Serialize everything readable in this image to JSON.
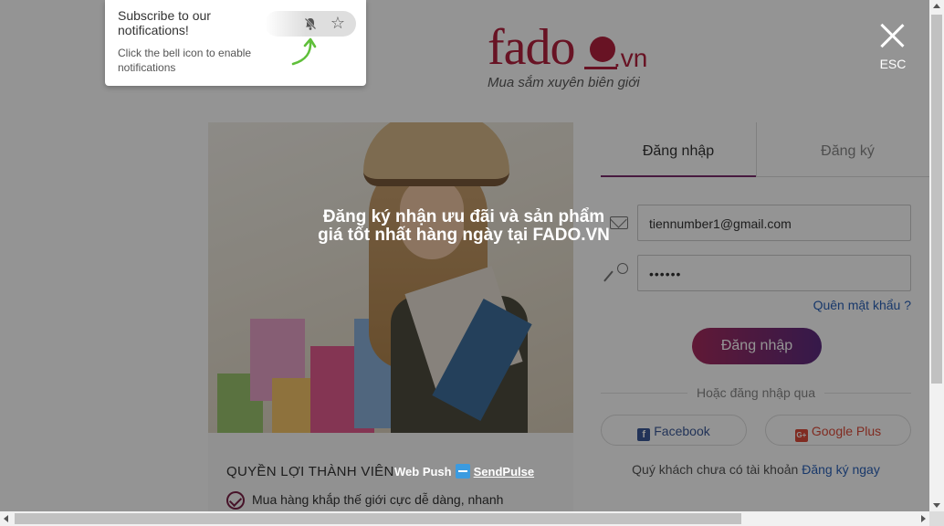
{
  "logo": {
    "brand": "fado",
    "ext": ".vn",
    "tagline": "Mua sắm xuyên biên giới"
  },
  "modal": {
    "close_label": "ESC",
    "headline": "Đăng ký nhận ưu đãi và sản phẩm giá tốt nhất hàng ngày tại FADO.VN",
    "powered_prefix": "Web Push",
    "powered_brand": "SendPulse"
  },
  "notification": {
    "title": "Subscribe to our notifications!",
    "description": "Click the bell icon to enable notifications",
    "star_glyph": "☆"
  },
  "login": {
    "tab_login": "Đăng nhập",
    "tab_register": "Đăng ký",
    "email_value": "tiennumber1@gmail.com",
    "password_value": "••••••",
    "forgot_link": "Quên mật khẩu ?",
    "submit_label": "Đăng nhập",
    "or_text": "Hoặc đăng nhập qua",
    "facebook_label": "Facebook",
    "google_label": "Google Plus",
    "facebook_icon_glyph": "f",
    "google_icon_glyph": "G+",
    "signup_prompt": "Quý khách chưa có tài khoản",
    "signup_link": "Đăng ký ngay"
  },
  "benefits": {
    "title": "QUYỀN LỢI THÀNH VIÊN",
    "items": [
      "Mua hàng khắp thế giới cực dễ dàng, nhanh"
    ]
  },
  "colors": {
    "brand": "#b4223e",
    "button_gradient_start": "#a62b5e",
    "button_gradient_end": "#5c2b80",
    "link": "#2b62b8",
    "facebook": "#3b5998",
    "google": "#dd4b39"
  }
}
